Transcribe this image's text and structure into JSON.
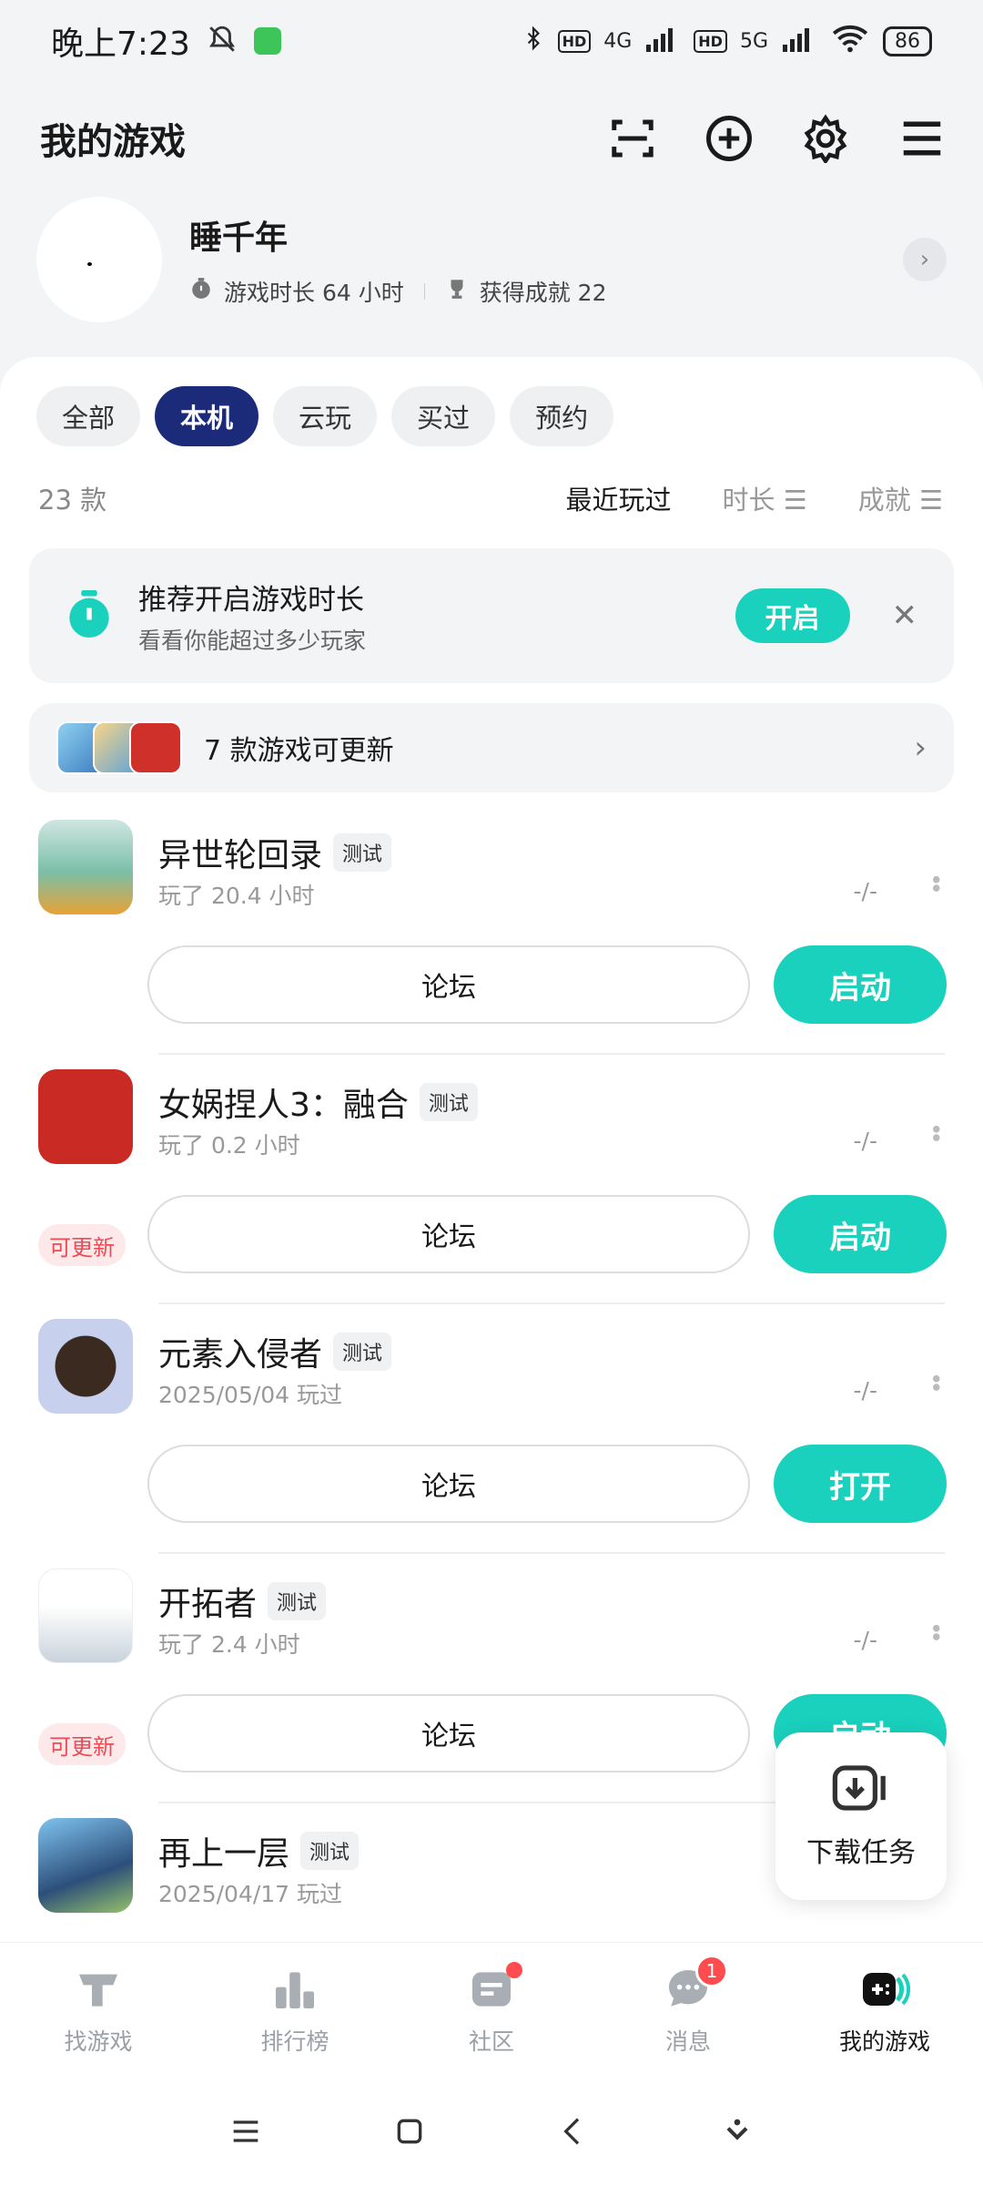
{
  "status": {
    "time": "晚上7:23",
    "net1": "4G",
    "net2": "5G",
    "hd": "HD",
    "battery": "86"
  },
  "header": {
    "title": "我的游戏"
  },
  "profile": {
    "name": "睡千年",
    "playtime_label": "游戏时长 64 小时",
    "achievement_label": "获得成就 22"
  },
  "tabs": [
    "全部",
    "本机",
    "云玩",
    "买过",
    "预约"
  ],
  "sort": {
    "count": "23 款",
    "recent": "最近玩过",
    "duration": "时长",
    "achievement": "成就"
  },
  "recommend": {
    "title": "推荐开启游戏时长",
    "subtitle": "看看你能超过多少玩家",
    "button": "开启",
    "close_icon": "close-icon"
  },
  "update_bar": {
    "text": "7 款游戏可更新"
  },
  "games": [
    {
      "name": "异世轮回录",
      "tag": "测试",
      "sub": "玩了 20.4 小时",
      "right": "-/-",
      "forum": "论坛",
      "action": "启动",
      "updatable": ""
    },
    {
      "name": "女娲捏人3：融合",
      "tag": "测试",
      "sub": "玩了 0.2 小时",
      "right": "-/-",
      "forum": "论坛",
      "action": "启动",
      "updatable": "可更新"
    },
    {
      "name": "元素入侵者",
      "tag": "测试",
      "sub": "2025/05/04 玩过",
      "right": "-/-",
      "forum": "论坛",
      "action": "打开",
      "updatable": ""
    },
    {
      "name": "开拓者",
      "tag": "测试",
      "sub": "玩了 2.4 小时",
      "right": "-/-",
      "forum": "论坛",
      "action": "启动",
      "updatable": "可更新"
    },
    {
      "name": "再上一层",
      "tag": "测试",
      "sub": "2025/04/17 玩过",
      "right": "",
      "forum": "",
      "action": "",
      "updatable": ""
    }
  ],
  "download": {
    "label": "下载任务"
  },
  "nav": [
    {
      "label": "找游戏",
      "icon": "find-games-icon"
    },
    {
      "label": "排行榜",
      "icon": "ranking-icon"
    },
    {
      "label": "社区",
      "icon": "community-icon"
    },
    {
      "label": "消息",
      "icon": "message-icon",
      "badge": "1"
    },
    {
      "label": "我的游戏",
      "icon": "my-games-icon"
    }
  ],
  "colors": {
    "accent": "#19d1bd",
    "tab_active": "#1c2a7a",
    "badge": "#ff4d4f"
  }
}
